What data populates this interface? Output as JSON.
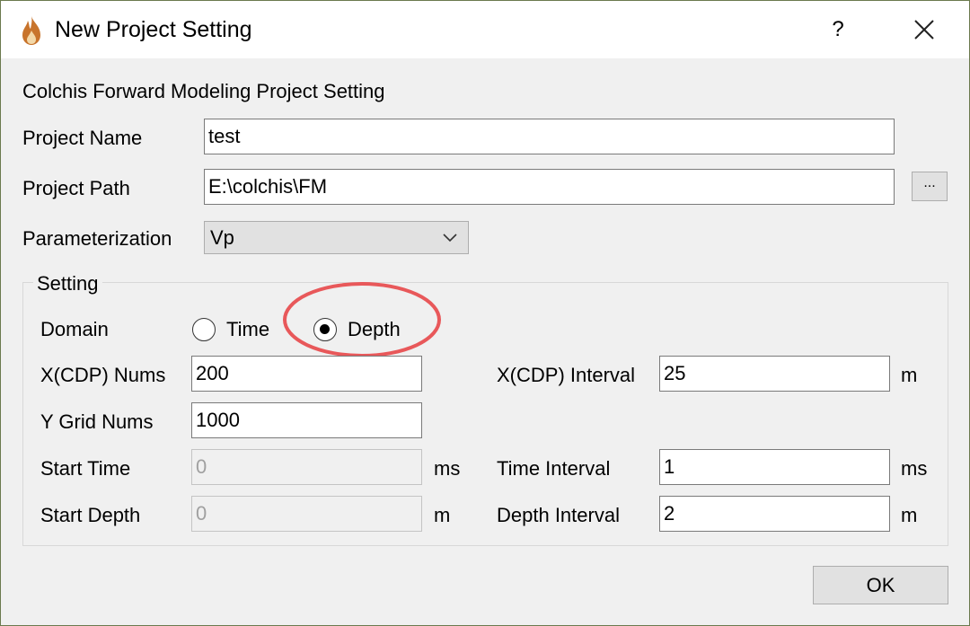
{
  "window": {
    "title": "New Project Setting",
    "help_label": "?",
    "icon": "flame-icon"
  },
  "header": {
    "subtitle": "Colchis Forward Modeling Project Setting"
  },
  "form": {
    "project_name": {
      "label": "Project Name",
      "value": "test"
    },
    "project_path": {
      "label": "Project Path",
      "value": "E:\\colchis\\FM",
      "browse_label": "..."
    },
    "parameterization": {
      "label": "Parameterization",
      "selected": "Vp"
    }
  },
  "setting": {
    "title": "Setting",
    "domain": {
      "label": "Domain",
      "options": [
        {
          "label": "Time",
          "checked": false
        },
        {
          "label": "Depth",
          "checked": true
        }
      ],
      "highlight_color": "#e8585a"
    },
    "xcdp_nums": {
      "label": "X(CDP) Nums",
      "value": "200"
    },
    "xcdp_interval": {
      "label": "X(CDP) Interval",
      "value": "25",
      "unit": "m"
    },
    "y_grid_nums": {
      "label": "Y Grid Nums",
      "value": "1000"
    },
    "start_time": {
      "label": "Start Time",
      "value": "0",
      "unit": "ms",
      "enabled": false
    },
    "time_interval": {
      "label": "Time Interval",
      "value": "1",
      "unit": "ms"
    },
    "start_depth": {
      "label": "Start Depth",
      "value": "0",
      "unit": "m",
      "enabled": false
    },
    "depth_interval": {
      "label": "Depth Interval",
      "value": "2",
      "unit": "m"
    }
  },
  "footer": {
    "ok_label": "OK"
  }
}
